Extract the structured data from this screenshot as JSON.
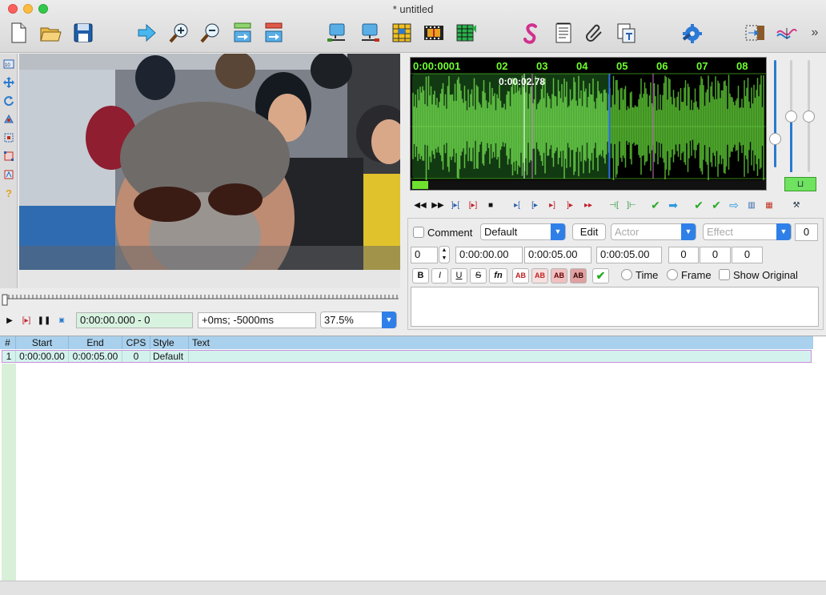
{
  "window": {
    "title": "* untitled"
  },
  "toolbar": {
    "items": [
      "new-file",
      "open-file",
      "save-file",
      "jump-to",
      "zoom-in",
      "zoom-out",
      "jump-video-start",
      "jump-video-end",
      "snap-start",
      "snap-end",
      "subtitle-grid",
      "video-filmstrip",
      "color-grid",
      "styles",
      "attachments-notes",
      "attach-files",
      "translation",
      "automation",
      "resample-tool",
      "timing-tool"
    ],
    "more": "»"
  },
  "video": {
    "time_display": "0:00:00.000 - 0",
    "offset_display": "+0ms; -5000ms",
    "zoom": "37.5%"
  },
  "audio": {
    "ruler": [
      "0:00:0001",
      "02",
      "03",
      "04",
      "05",
      "06",
      "07",
      "08"
    ],
    "cursor_time": "0:00:02.78",
    "selection_end_fraction": 0.5,
    "colors": {
      "selection": "#5fbf43",
      "wave": "#4ea82c",
      "ruler": "#6fff2f"
    }
  },
  "editor": {
    "comment_label": "Comment",
    "style_value": "Default",
    "edit_label": "Edit",
    "actor_placeholder": "Actor",
    "effect_placeholder": "Effect",
    "layer_count": "0",
    "layer": "0",
    "start_time": "0:00:00.00",
    "end_time": "0:00:05.00",
    "duration": "0:00:05.00",
    "margin_l": "0",
    "margin_r": "0",
    "margin_v": "0",
    "format_buttons": [
      "B",
      "I",
      "U",
      "S",
      "fn",
      "AB",
      "AB",
      "AB",
      "AB"
    ],
    "time_label": "Time",
    "frame_label": "Frame",
    "show_original_label": "Show Original",
    "text": ""
  },
  "grid": {
    "headers": [
      "#",
      "Start",
      "End",
      "CPS",
      "Style",
      "Text"
    ],
    "rows": [
      {
        "num": "1",
        "start": "0:00:00.00",
        "end": "0:00:05.00",
        "cps": "0",
        "style": "Default",
        "text": ""
      }
    ]
  }
}
